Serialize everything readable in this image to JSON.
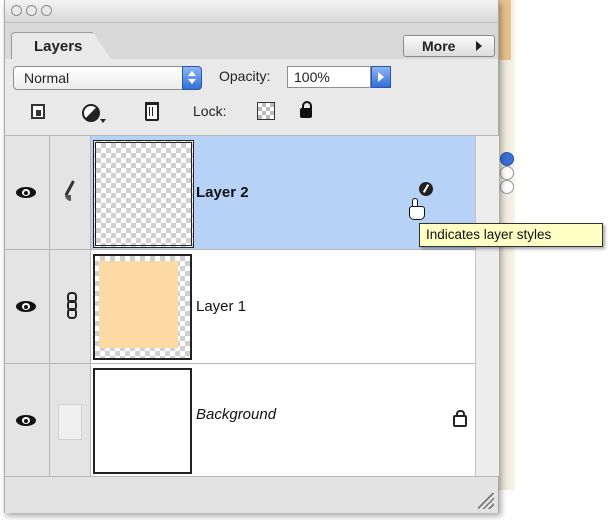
{
  "panel": {
    "tab_label": "Layers",
    "more_label": "More"
  },
  "controls": {
    "blend_mode": "Normal",
    "opacity_label": "Opacity:",
    "opacity_value": "100%",
    "lock_label": "Lock:"
  },
  "icons": {
    "window_buttons": [
      "close-icon",
      "minimize-icon",
      "zoom-icon"
    ],
    "toolbar": [
      "new-layer-set-icon",
      "adjustment-layer-icon",
      "trash-icon"
    ],
    "locks": [
      "lock-transparency-icon",
      "lock-all-icon"
    ],
    "layer_style": "layer-style-icon",
    "cursor": "hand-pointer-icon"
  },
  "layers": [
    {
      "name": "Layer 2",
      "selected": true,
      "has_style": true
    },
    {
      "name": "Layer 1",
      "selected": false,
      "linked": true
    },
    {
      "name": "Background",
      "selected": false,
      "locked": true
    }
  ],
  "tooltip": {
    "text": "Indicates layer styles"
  },
  "colors": {
    "selection": "#b6d3f7",
    "layer1_fill": "#fdd9a3",
    "tooltip_bg": "#ffffc5",
    "accent_blue": "#2f6fd8"
  }
}
